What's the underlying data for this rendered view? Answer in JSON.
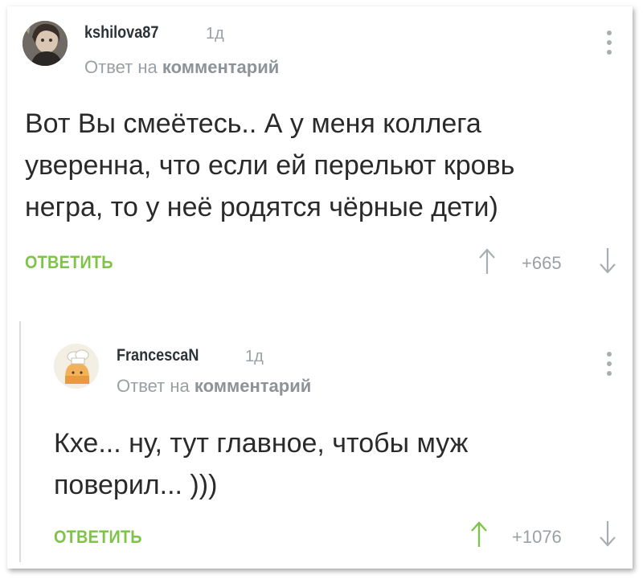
{
  "comments": [
    {
      "username": "kshilova87",
      "time": "1д",
      "reply_prefix": "Ответ на",
      "reply_target": "комментарий",
      "text_lines": [
        "Вот Вы смеётесь.. А у меня коллега",
        "уверенна, что если ей перельют кровь",
        "негра, то у неё родятся чёрные дети)"
      ],
      "reply_label": "ОТВЕТИТЬ",
      "rating": "+665"
    },
    {
      "username": "FrancescaN",
      "time": "1д",
      "reply_prefix": "Ответ на",
      "reply_target": "комментарий",
      "text_lines": [
        "Кхе... ну, тут главное, чтобы муж",
        "поверил... )))"
      ],
      "reply_label": "ОТВЕТИТЬ",
      "rating": "+1076"
    }
  ],
  "colors": {
    "accent_green": "#7fc44a",
    "meta_gray": "#9aa0a4",
    "text": "#2a2a2a"
  },
  "icons": [
    "avatar",
    "more-vertical-icon",
    "arrow-up-icon",
    "arrow-down-icon"
  ]
}
